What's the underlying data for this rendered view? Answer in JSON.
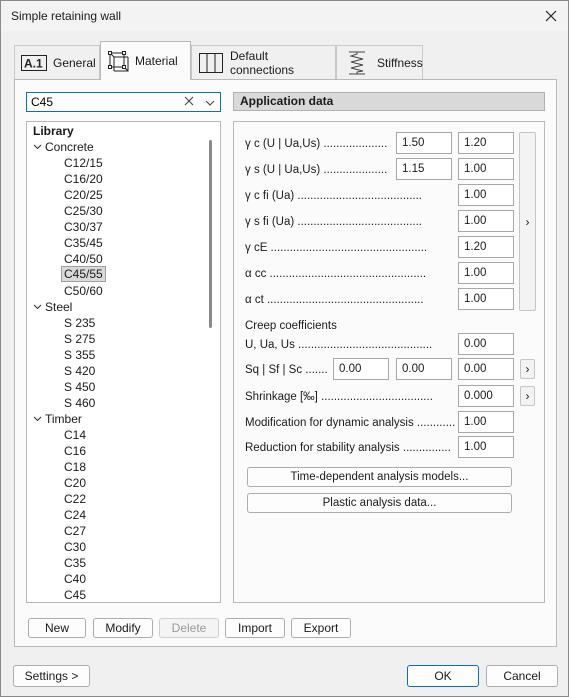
{
  "window": {
    "title": "Simple retaining wall"
  },
  "tabs": [
    {
      "label": "General",
      "icon": "a1-icon"
    },
    {
      "label": "Material",
      "icon": "material-cube-icon"
    },
    {
      "label": "Default connections",
      "icon": "connections-icon"
    },
    {
      "label": "Stiffness",
      "icon": "spring-icon"
    }
  ],
  "search": {
    "value": "C45"
  },
  "library": {
    "title": "Library",
    "groups": [
      {
        "label": "Concrete",
        "items": [
          "C12/15",
          "C16/20",
          "C20/25",
          "C25/30",
          "C30/37",
          "C35/45",
          "C40/50",
          "C45/55",
          "C50/60"
        ]
      },
      {
        "label": "Steel",
        "items": [
          "S 235",
          "S 275",
          "S 355",
          "S 420",
          "S 450",
          "S 460"
        ]
      },
      {
        "label": "Timber",
        "items": [
          "C14",
          "C16",
          "C18",
          "C20",
          "C22",
          "C24",
          "C27",
          "C30",
          "C35",
          "C40",
          "C45"
        ]
      }
    ],
    "selected": "C45/55"
  },
  "actions": {
    "new": "New",
    "modify": "Modify",
    "delete": "Delete",
    "import": "Import",
    "export": "Export"
  },
  "application": {
    "header": "Application data",
    "rows": {
      "gc": {
        "label": "γ c (U | Ua,Us) ....................",
        "v1": "1.50",
        "v2": "1.20"
      },
      "gs": {
        "label": "γ s (U | Ua,Us) ....................",
        "v1": "1.15",
        "v2": "1.00"
      },
      "gcfi": {
        "label": "γ c fi (Ua) .......................................",
        "v": "1.00"
      },
      "gsfi": {
        "label": "γ s fi (Ua) .......................................",
        "v": "1.00"
      },
      "gce": {
        "label": "γ cE .................................................",
        "v": "1.20"
      },
      "acc": {
        "label": "α cc .................................................",
        "v": "1.00"
      },
      "act": {
        "label": "α ct .................................................",
        "v": "1.00"
      }
    },
    "creep": {
      "title": "Creep coefficients",
      "u": {
        "label": "U, Ua, Us ..........................................",
        "v": "0.00"
      },
      "sq": {
        "label": "Sq | Sf | Sc .......",
        "v1": "0.00",
        "v2": "0.00",
        "v3": "0.00"
      }
    },
    "shrinkage": {
      "label": "Shrinkage [‰] ...................................",
      "v": "0.000"
    },
    "dynamic": {
      "label": "Modification for dynamic analysis ............",
      "v": "1.00"
    },
    "stability": {
      "label": "Reduction for stability analysis ...............",
      "v": "1.00"
    },
    "side_arrow": "›",
    "time_button": "Time-dependent analysis models...",
    "plastic_button": "Plastic analysis data..."
  },
  "footer": {
    "settings": "Settings >",
    "ok": "OK",
    "cancel": "Cancel"
  }
}
